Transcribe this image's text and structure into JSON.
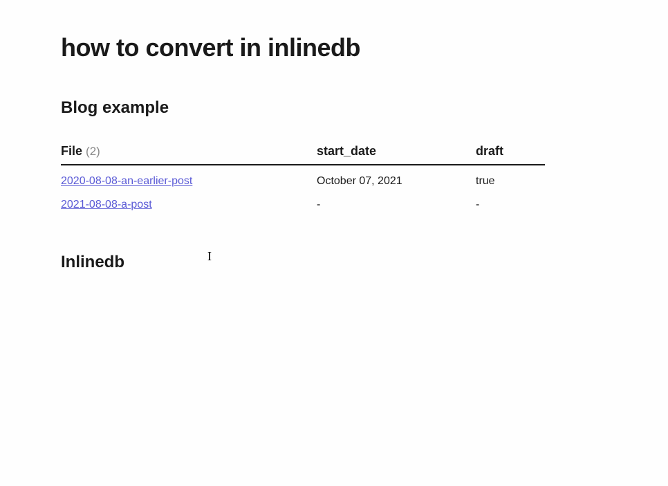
{
  "page": {
    "title": "how to convert in inlinedb"
  },
  "sections": {
    "blog_example": {
      "heading": "Blog example",
      "table": {
        "columns": {
          "file_label": "File",
          "file_count": "(2)",
          "start_label": "start_date",
          "draft_label": "draft"
        },
        "rows": [
          {
            "file": "2020-08-08-an-earlier-post",
            "start_date": "October 07, 2021",
            "draft": "true"
          },
          {
            "file": "2021-08-08-a-post",
            "start_date": "-",
            "draft": "-"
          }
        ]
      }
    },
    "inlinedb": {
      "heading": "Inlinedb"
    }
  }
}
